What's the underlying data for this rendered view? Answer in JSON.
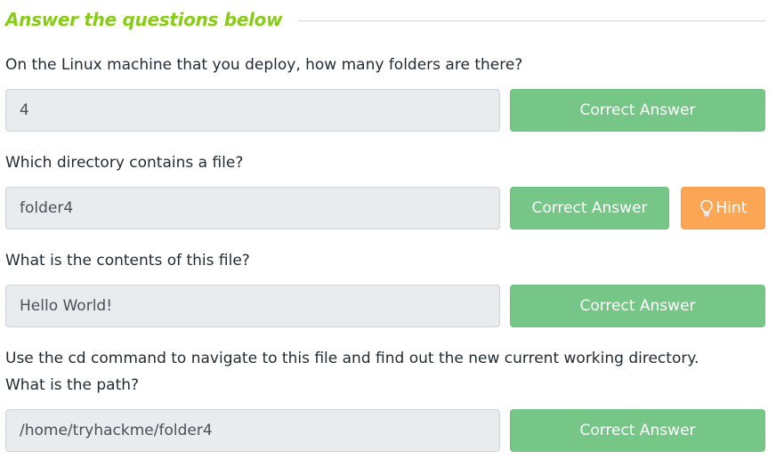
{
  "section": {
    "title": "Answer the questions below"
  },
  "questions": [
    {
      "text": "On the Linux machine that you deploy, how many folders are there?",
      "answer": "4",
      "button_label": "Correct Answer"
    },
    {
      "text": "Which directory contains a file?",
      "answer": "folder4",
      "button_label": "Correct Answer",
      "hint_label": "Hint",
      "hint_icon": "lightbulb-icon"
    },
    {
      "text": "What is the contents of this file?",
      "answer": "Hello World!",
      "button_label": "Correct Answer"
    },
    {
      "text_line1": "Use the cd command to navigate to this file and find out the new current working directory.",
      "text_line2": "What is the path?",
      "answer": "/home/tryhackme/folder4",
      "button_label": "Correct Answer"
    }
  ],
  "colors": {
    "title": "#88cc14",
    "correct_button": "#75c687",
    "hint_button": "#fca656",
    "input_background": "#e9ecef"
  }
}
